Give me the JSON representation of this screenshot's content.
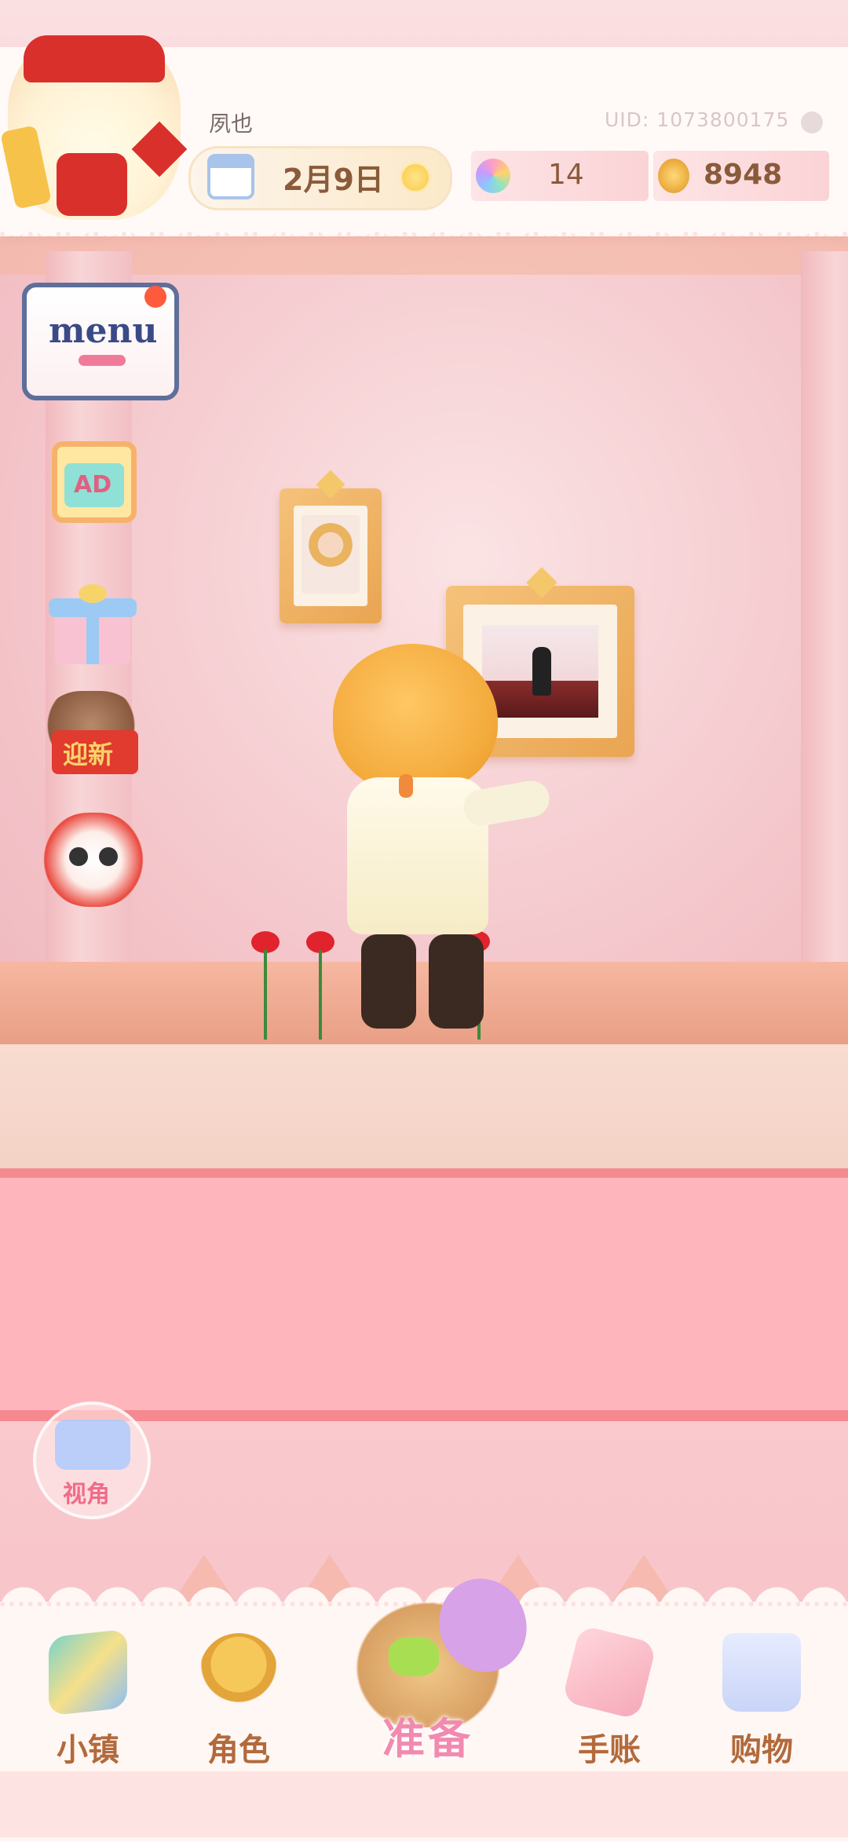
{
  "player": {
    "name": "夙也",
    "uid": "UID: 1073800175",
    "date": "2月9日",
    "gems": "14",
    "coins": "8948"
  },
  "side_buttons": {
    "menu_label": "menu",
    "ad_label": "AD",
    "cat_sign": "迎新"
  },
  "camera_label": "视角",
  "nav": {
    "items": [
      {
        "label": "小镇",
        "icon": "map-icon"
      },
      {
        "label": "角色",
        "icon": "character-icon"
      },
      {
        "label": "准备",
        "icon": "basket-icon"
      },
      {
        "label": "手账",
        "icon": "journal-icon"
      },
      {
        "label": "购物",
        "icon": "shopping-bag-icon"
      }
    ]
  },
  "colors": {
    "accent_pink": "#f28ab0",
    "label_brown": "#b26a3c",
    "wall_pink": "#f3c3c8"
  }
}
